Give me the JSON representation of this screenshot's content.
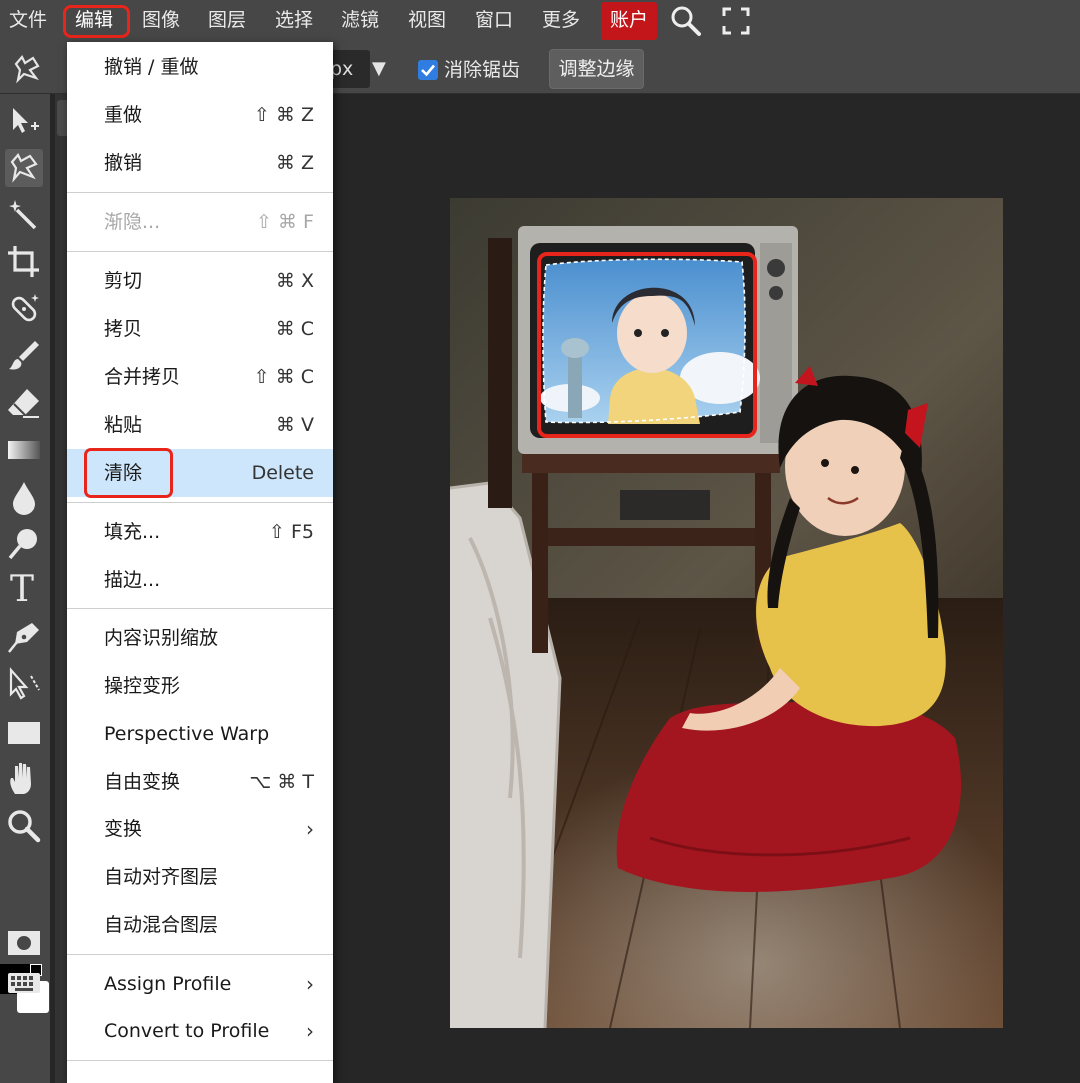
{
  "menubar": {
    "items": [
      "文件",
      "编辑",
      "图像",
      "图层",
      "选择",
      "滤镜",
      "视图",
      "窗口",
      "更多"
    ],
    "account": "账户",
    "search_icon": "search-icon",
    "fullscreen_icon": "fullscreen-icon"
  },
  "options": {
    "field_suffix": "px",
    "caret": "▼",
    "antialias_label": "消除锯齿",
    "antialias_checked": true,
    "refine_edge": "调整边缘"
  },
  "toolbar": {
    "tools": [
      "move-tool-icon",
      "lasso-tool-icon",
      "magic-wand-icon",
      "crop-icon",
      "healing-brush-icon",
      "brush-icon",
      "eraser-icon",
      "gradient-icon",
      "blur-icon",
      "dodge-icon",
      "text-tool-icon",
      "pen-tool-icon",
      "path-select-icon",
      "rectangle-tool-icon",
      "hand-tool-icon",
      "zoom-tool-icon",
      "mask-icon",
      "keyboard-icon"
    ],
    "text_tool_glyph": "T"
  },
  "edit_menu": {
    "items": [
      {
        "label": "撤销 / 重做",
        "shortcut": ""
      },
      {
        "label": "重做",
        "shortcut": "⇧ ⌘ Z"
      },
      {
        "label": "撤销",
        "shortcut": "⌘ Z"
      },
      {
        "label": "渐隐...",
        "shortcut": "⇧ ⌘ F",
        "disabled": true
      },
      {
        "label": "剪切",
        "shortcut": "⌘ X"
      },
      {
        "label": "拷贝",
        "shortcut": "⌘ C"
      },
      {
        "label": "合并拷贝",
        "shortcut": "⇧ ⌘ C"
      },
      {
        "label": "粘贴",
        "shortcut": "⌘ V"
      },
      {
        "label": "清除",
        "shortcut": "Delete",
        "highlighted": true
      },
      {
        "label": "填充...",
        "shortcut": "⇧ F5"
      },
      {
        "label": "描边...",
        "shortcut": ""
      },
      {
        "label": "内容识别缩放",
        "shortcut": ""
      },
      {
        "label": "操控变形",
        "shortcut": ""
      },
      {
        "label": "Perspective Warp",
        "shortcut": ""
      },
      {
        "label": "自由变换",
        "shortcut": "⌥ ⌘ T"
      },
      {
        "label": "变换",
        "shortcut": "",
        "submenu": true
      },
      {
        "label": "自动对齐图层",
        "shortcut": ""
      },
      {
        "label": "自动混合图层",
        "shortcut": ""
      },
      {
        "label": "Assign Profile",
        "shortcut": "",
        "submenu": true
      },
      {
        "label": "Convert to Profile",
        "shortcut": "",
        "submenu": true
      }
    ],
    "submenu_arrow": "›"
  },
  "colors": {
    "accent_red": "#e8251a",
    "account_red": "#c3161b",
    "menu_highlight": "#cde6fb",
    "checkbox_blue": "#2f7de1"
  }
}
